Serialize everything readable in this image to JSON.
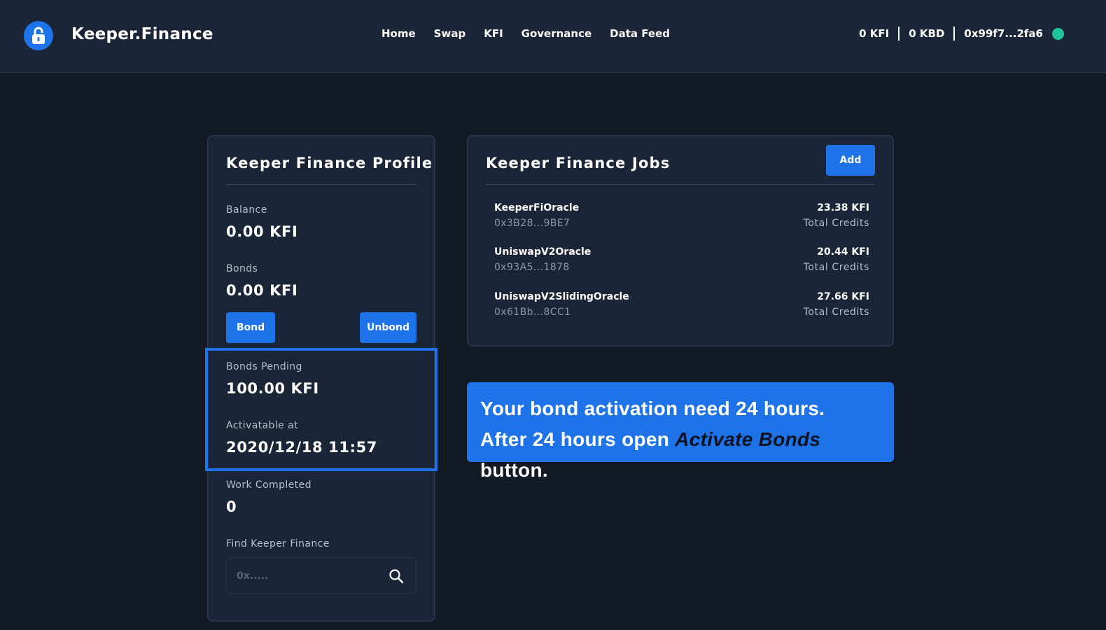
{
  "header": {
    "brand": "Keeper.Finance",
    "nav": [
      "Home",
      "Swap",
      "KFI",
      "Governance",
      "Data Feed"
    ],
    "wallet": {
      "kfi": "0 KFI",
      "kbd": "0 KBD",
      "address": "0x99f7...2fa6",
      "status_color": "#1fc49a"
    }
  },
  "profile": {
    "title": "Keeper Finance Profile",
    "balance_label": "Balance",
    "balance_value": "0.00 KFI",
    "bonds_label": "Bonds",
    "bonds_value": "0.00 KFI",
    "bond_button": "Bond",
    "unbond_button": "Unbond",
    "bonds_pending_label": "Bonds Pending",
    "bonds_pending_value": "100.00 KFI",
    "activatable_label": "Activatable at",
    "activatable_value": "2020/12/18 11:57",
    "work_label": "Work Completed",
    "work_value": "0",
    "find_label": "Find Keeper Finance",
    "search_placeholder": "0x.....",
    "search_icon": "search-icon"
  },
  "jobs": {
    "title": "Keeper Finance Jobs",
    "add_button": "Add",
    "items": [
      {
        "name": "KeeperFiOracle",
        "address": "0x3B28...9BE7",
        "amount": "23.38 KFI",
        "sub": "Total Credits"
      },
      {
        "name": "UniswapV2Oracle",
        "address": "0x93A5...1878",
        "amount": "20.44 KFI",
        "sub": "Total Credits"
      },
      {
        "name": "UniswapV2SlidingOracle",
        "address": "0x61Bb...8CC1",
        "amount": "27.66 KFI",
        "sub": "Total Credits"
      }
    ]
  },
  "notice": {
    "line1": "Your bond activation need 24 hours.",
    "line2_pre": "After 24 hours open ",
    "line2_em": "Activate Bonds",
    "line2_post": " button."
  },
  "colors": {
    "accent": "#1e73e8",
    "background": "#131a26",
    "card": "#1b2538"
  }
}
